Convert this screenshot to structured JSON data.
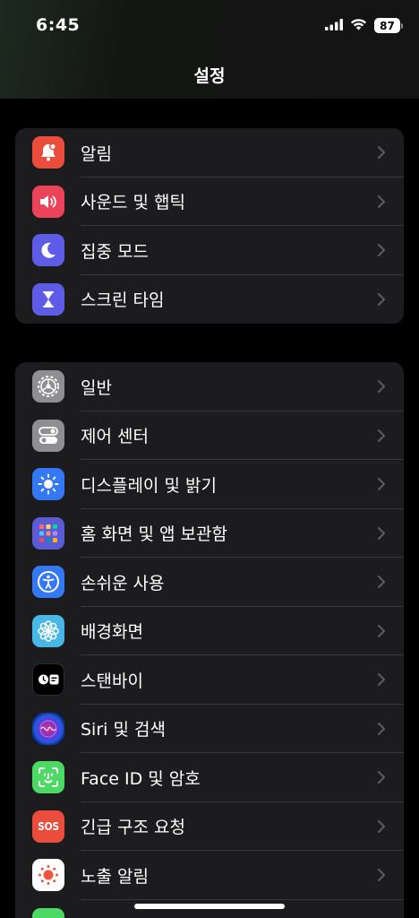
{
  "status_bar": {
    "time": "6:45",
    "battery_level": "87",
    "icons": [
      "cellular-signal-icon",
      "wifi-icon",
      "battery-icon"
    ]
  },
  "nav": {
    "title": "설정"
  },
  "groups": [
    {
      "items": [
        {
          "label": "알림",
          "icon": "bell-icon",
          "color": "#eb4d3d"
        },
        {
          "label": "사운드 및 햅틱",
          "icon": "speaker-icon",
          "color": "#eb445a"
        },
        {
          "label": "집중 모드",
          "icon": "moon-icon",
          "color": "#5e5ce6"
        },
        {
          "label": "스크린 타임",
          "icon": "hourglass-icon",
          "color": "#5e5ce6"
        }
      ]
    },
    {
      "items": [
        {
          "label": "일반",
          "icon": "gear-icon",
          "color": "#8e8e93"
        },
        {
          "label": "제어 센터",
          "icon": "toggles-icon",
          "color": "#8e8e93"
        },
        {
          "label": "디스플레이 및 밝기",
          "icon": "sun-icon",
          "color": "#3478f6"
        },
        {
          "label": "홈 화면 및 앱 보관함",
          "icon": "app-grid-icon",
          "color": "#5c5bd6"
        },
        {
          "label": "손쉬운 사용",
          "icon": "accessibility-icon",
          "color": "#3478f6"
        },
        {
          "label": "배경화면",
          "icon": "flower-icon",
          "color": "#47b8e8"
        },
        {
          "label": "스탠바이",
          "icon": "standby-icon",
          "color": "#000000"
        },
        {
          "label": "Siri 및 검색",
          "icon": "siri-icon",
          "color": "#1a1a2e"
        },
        {
          "label": "Face ID 및 암호",
          "icon": "face-id-icon",
          "color": "#4cd964"
        },
        {
          "label": "긴급 구조 요청",
          "icon": "sos-icon",
          "color": "#eb4d3d",
          "icon_text": "SOS"
        },
        {
          "label": "노출 알림",
          "icon": "exposure-icon",
          "color": "#ffffff"
        },
        {
          "label": "",
          "icon": "battery-settings-icon",
          "color": "#4cd964"
        }
      ]
    }
  ]
}
